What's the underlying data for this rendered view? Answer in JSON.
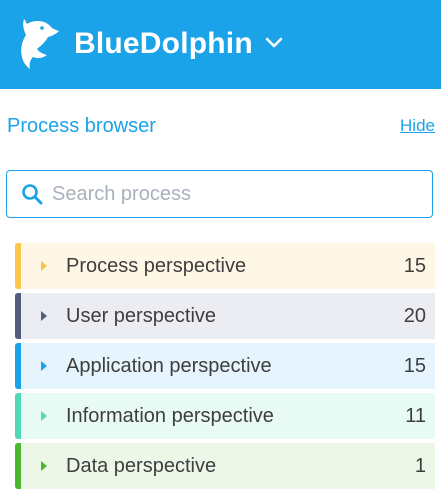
{
  "header": {
    "app_name": "BlueDolphin",
    "background": "#1aa3e8",
    "logo_icon": "dolphin-logo-icon",
    "menu_icon": "chevron-down-icon"
  },
  "browser": {
    "title": "Process browser",
    "hide_label": "Hide"
  },
  "search": {
    "placeholder": "Search process",
    "value": "",
    "icon": "search-icon"
  },
  "perspectives": [
    {
      "label": "Process perspective",
      "count": "15",
      "accent": "#fcc64a",
      "bg": "#fff7e6",
      "caret": "#f8c44c"
    },
    {
      "label": "User perspective",
      "count": "20",
      "accent": "#525c7c",
      "bg": "#ecedf2",
      "caret": "#525c7c"
    },
    {
      "label": "Application perspective",
      "count": "15",
      "accent": "#1aa3e8",
      "bg": "#e5f4fd",
      "caret": "#1aa3e8"
    },
    {
      "label": "Information perspective",
      "count": "11",
      "accent": "#50d9b3",
      "bg": "#e8faf4",
      "caret": "#50d9b3"
    },
    {
      "label": "Data perspective",
      "count": "1",
      "accent": "#4cb82e",
      "bg": "#ecf7e8",
      "caret": "#4cb82e"
    }
  ]
}
